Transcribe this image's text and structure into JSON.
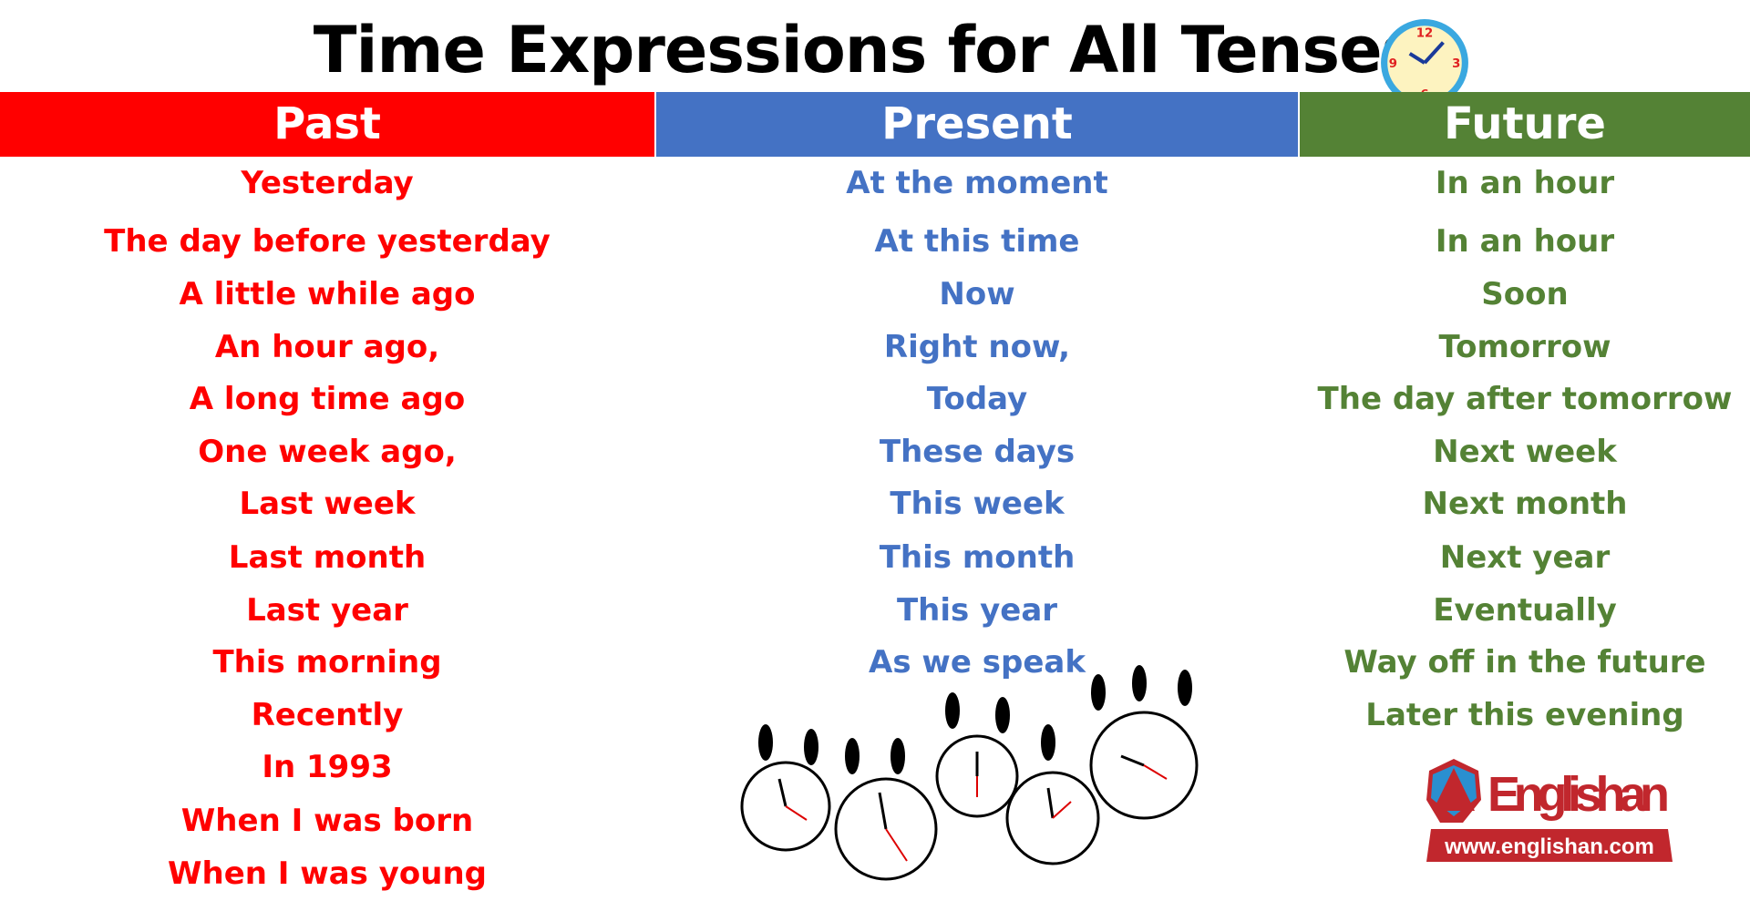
{
  "title": "Time Expressions for All Tenses",
  "colors": {
    "past": "#ff0000",
    "present": "#4472c4",
    "future": "#548235"
  },
  "columns": [
    {
      "header": "Past",
      "items": [
        "Yesterday",
        "The day before yesterday",
        "A little while ago",
        "An hour ago,",
        "A long time ago",
        "One week ago,",
        "Last week",
        "Last month",
        "Last year",
        "This morning",
        "Recently",
        "In 1993",
        "When I was born",
        "When I was young"
      ]
    },
    {
      "header": "Present",
      "items": [
        "At the moment",
        "At this time",
        "Now",
        "Right now,",
        "Today",
        "These days",
        "This week",
        "This month",
        "This year",
        "As we speak"
      ]
    },
    {
      "header": "Future",
      "items": [
        "In an hour",
        "In an hour",
        "Soon",
        "Tomorrow",
        "The day after tomorrow",
        "Next week",
        "Next month",
        "Next year",
        "Eventually",
        "Way off in the future",
        "Later this evening"
      ]
    }
  ],
  "logo": {
    "name": "Englishan",
    "url": "www.englishan.com"
  }
}
